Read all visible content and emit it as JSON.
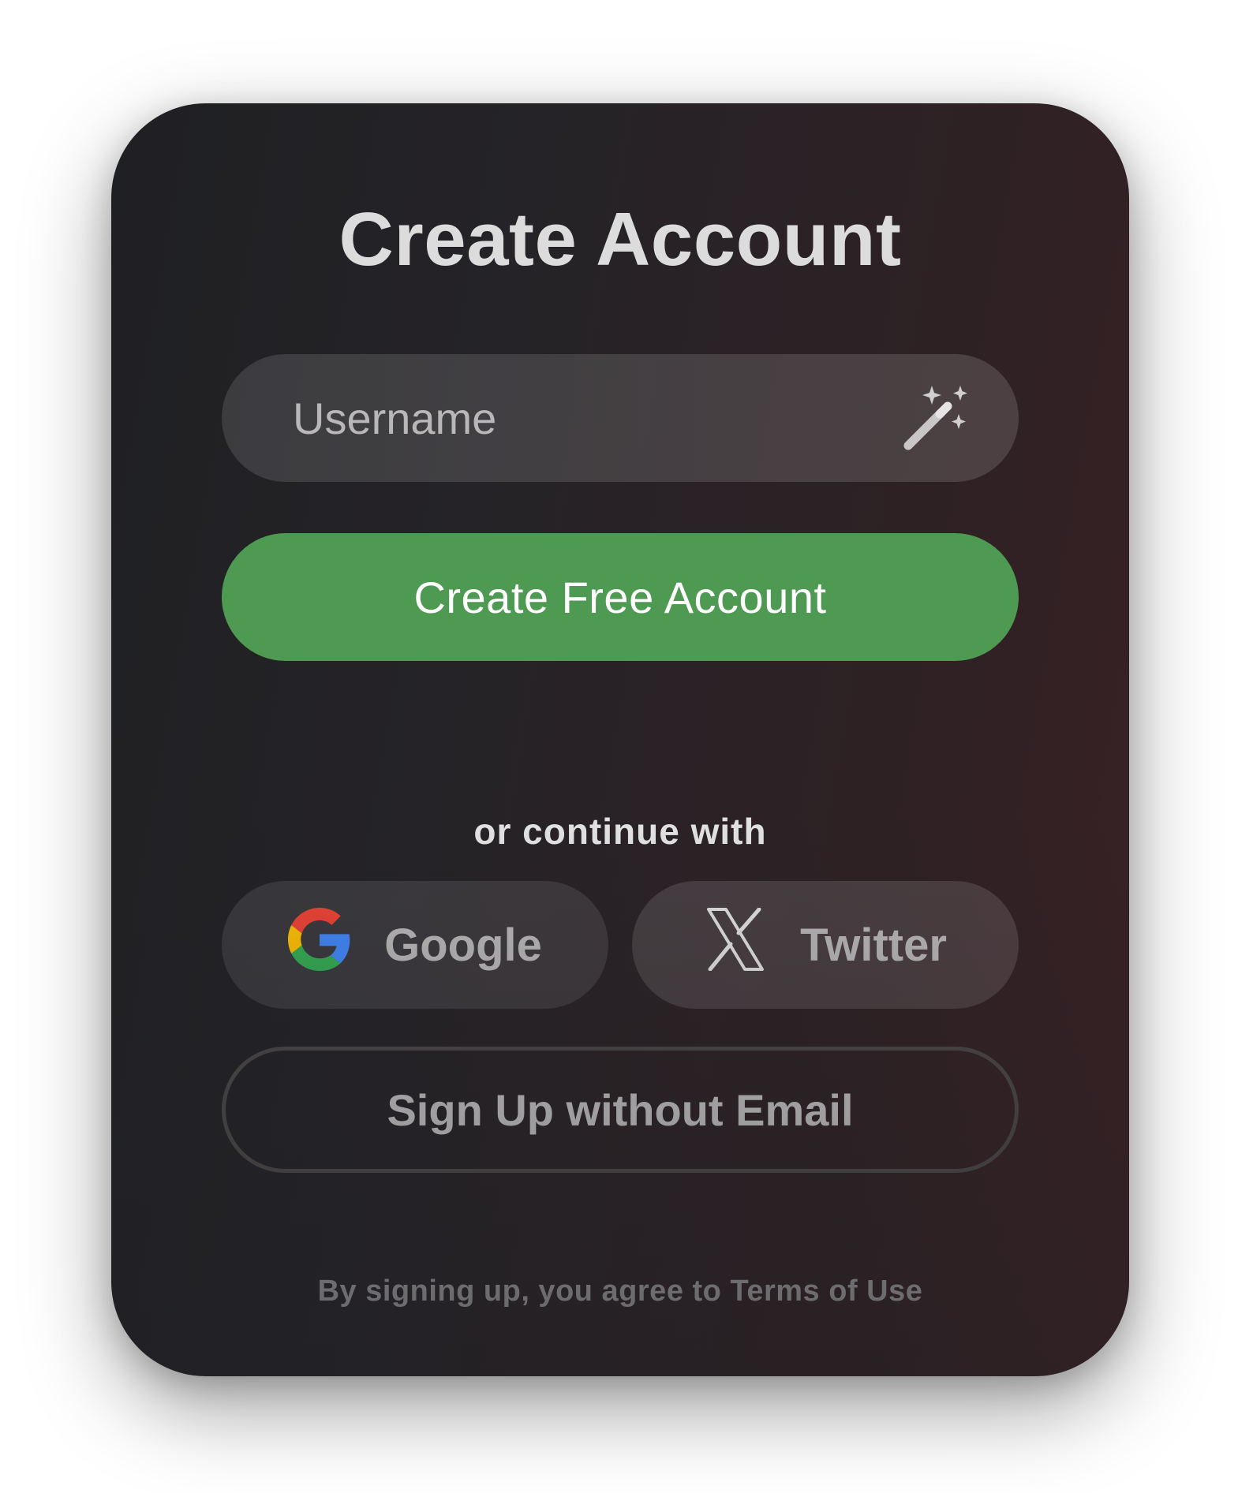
{
  "title": "Create Account",
  "username": {
    "placeholder": "Username",
    "value": "",
    "suggest_icon": "magic-wand-icon"
  },
  "primary_button": {
    "label": "Create Free Account",
    "color": "#4f9a53"
  },
  "divider_text": "or continue with",
  "social": {
    "google": {
      "label": "Google",
      "icon": "google-icon"
    },
    "twitter": {
      "label": "Twitter",
      "icon": "x-logo-icon"
    }
  },
  "no_email_button": {
    "label": "Sign Up without Email"
  },
  "terms": {
    "prefix": "By signing up, you agree to ",
    "link": "Terms of Use"
  }
}
